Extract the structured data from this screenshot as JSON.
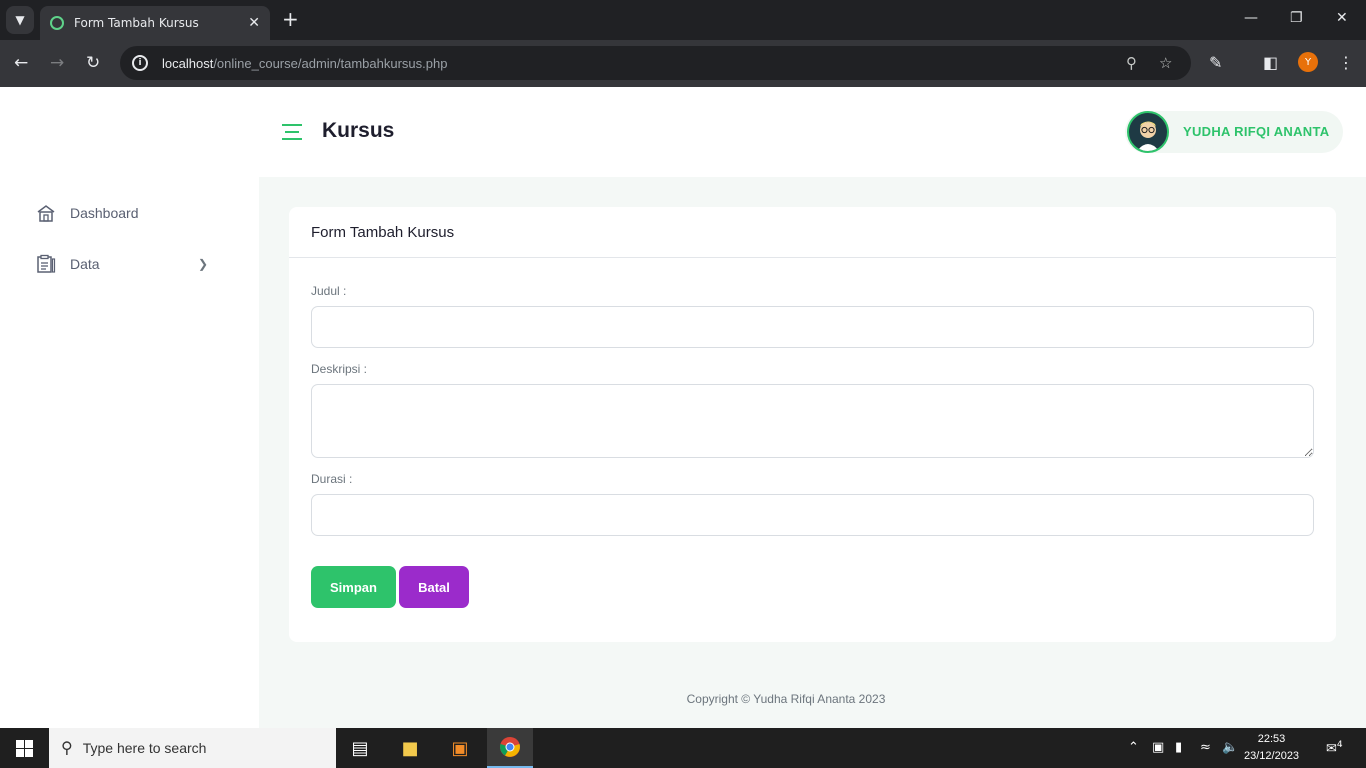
{
  "browser": {
    "tab_title": "Form Tambah Kursus",
    "url_host": "localhost",
    "url_path": "/online_course/admin/tambahkursus.php",
    "profile_initial": "Y"
  },
  "sidebar": {
    "items": [
      {
        "label": "Dashboard",
        "icon": "home-icon"
      },
      {
        "label": "Data",
        "icon": "clipboard-icon"
      }
    ]
  },
  "header": {
    "title": "Kursus",
    "user_name": "YUDHA RIFQI ANANTA"
  },
  "form": {
    "title": "Form Tambah Kursus",
    "judul_label": "Judul :",
    "judul_value": "",
    "deskripsi_label": "Deskripsi :",
    "deskripsi_value": "",
    "durasi_label": "Durasi :",
    "durasi_value": "",
    "save_label": "Simpan",
    "cancel_label": "Batal"
  },
  "footer": {
    "copyright": "Copyright © Yudha Rifqi Ananta 2023"
  },
  "taskbar": {
    "search_placeholder": "Type here to search",
    "time": "22:53",
    "date": "23/12/2023",
    "notification_count": "4"
  },
  "colors": {
    "accent_green": "#2ec36b",
    "accent_purple": "#9b2bcb"
  }
}
